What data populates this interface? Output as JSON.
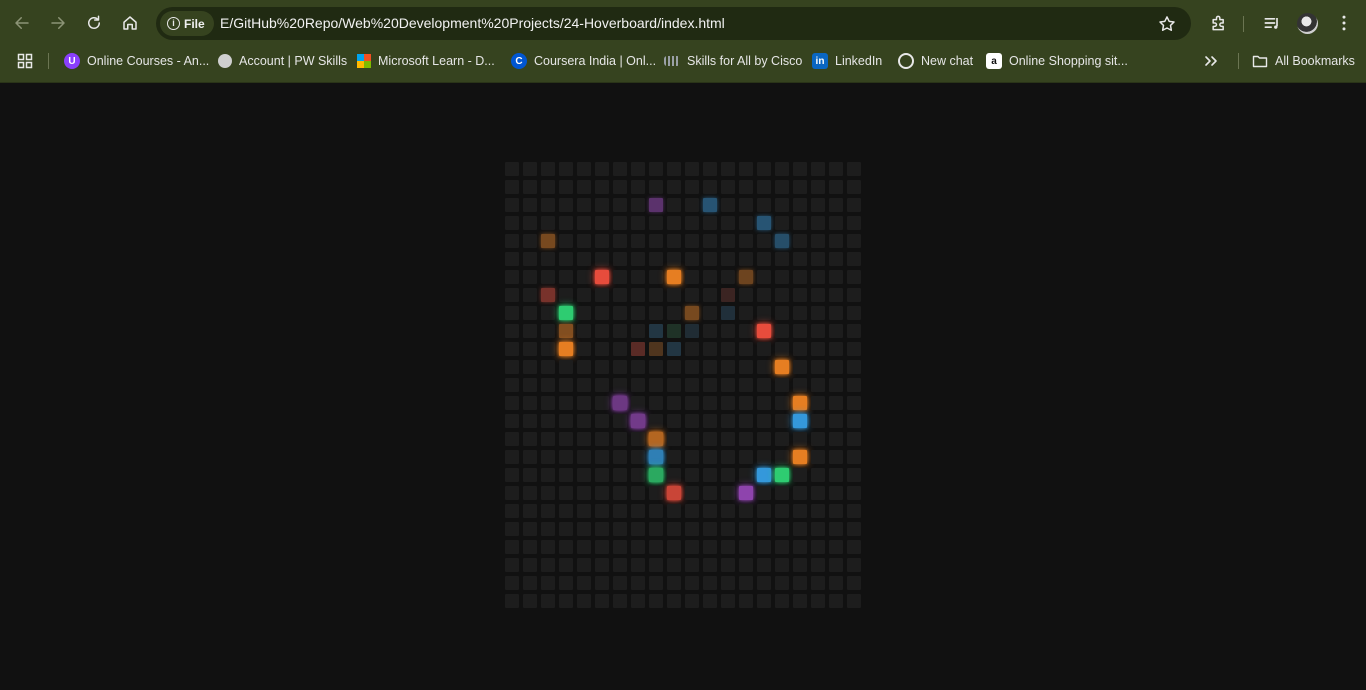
{
  "browser": {
    "site_chip_label": "File",
    "url": "E/GitHub%20Repo/Web%20Development%20Projects/24-Hoverboard/index.html",
    "bookmarks": [
      {
        "label": "Online Courses - An...",
        "icon": "udemy-icon",
        "color": "#8a3ffc"
      },
      {
        "label": "Account | PW Skills",
        "icon": "globe-icon",
        "color": "#cfcfcf"
      },
      {
        "label": "Microsoft Learn - D...",
        "icon": "microsoft-icon",
        "color": "#f25022"
      },
      {
        "label": "Coursera India | Onl...",
        "icon": "coursera-icon",
        "color": "#0056d2"
      },
      {
        "label": "Skills for All by Cisco",
        "icon": "cisco-icon",
        "color": "#9aa0a6"
      },
      {
        "label": "LinkedIn",
        "icon": "linkedin-icon",
        "color": "#0a66c2"
      },
      {
        "label": "New chat",
        "icon": "openai-icon",
        "color": "#ffffff"
      },
      {
        "label": "Online Shopping sit...",
        "icon": "amazon-icon",
        "color": "#ffffff"
      }
    ],
    "all_bookmarks_label": "All Bookmarks"
  },
  "board": {
    "columns": 20,
    "rows": 25,
    "base_color": "#1d1d1d",
    "page_background": "#111111",
    "lit_squares": [
      {
        "row": 2,
        "col": 8,
        "color": "#8e44ad",
        "intensity": 0.55
      },
      {
        "row": 2,
        "col": 11,
        "color": "#3498db",
        "intensity": 0.45
      },
      {
        "row": 3,
        "col": 14,
        "color": "#3498db",
        "intensity": 0.45
      },
      {
        "row": 4,
        "col": 2,
        "color": "#e67e22",
        "intensity": 0.45
      },
      {
        "row": 4,
        "col": 15,
        "color": "#3498db",
        "intensity": 0.4
      },
      {
        "row": 6,
        "col": 5,
        "color": "#e74c3c",
        "intensity": 1.0
      },
      {
        "row": 6,
        "col": 9,
        "color": "#e67e22",
        "intensity": 1.0
      },
      {
        "row": 6,
        "col": 13,
        "color": "#e67e22",
        "intensity": 0.4
      },
      {
        "row": 7,
        "col": 2,
        "color": "#e74c3c",
        "intensity": 0.45
      },
      {
        "row": 7,
        "col": 12,
        "color": "#e74c3c",
        "intensity": 0.15
      },
      {
        "row": 8,
        "col": 3,
        "color": "#2ecc71",
        "intensity": 1.0
      },
      {
        "row": 8,
        "col": 10,
        "color": "#e67e22",
        "intensity": 0.45
      },
      {
        "row": 8,
        "col": 12,
        "color": "#3498db",
        "intensity": 0.15
      },
      {
        "row": 9,
        "col": 3,
        "color": "#e67e22",
        "intensity": 0.5
      },
      {
        "row": 9,
        "col": 8,
        "color": "#3498db",
        "intensity": 0.2
      },
      {
        "row": 9,
        "col": 9,
        "color": "#2ecc71",
        "intensity": 0.12
      },
      {
        "row": 9,
        "col": 10,
        "color": "#3498db",
        "intensity": 0.12
      },
      {
        "row": 9,
        "col": 14,
        "color": "#e74c3c",
        "intensity": 1.0
      },
      {
        "row": 10,
        "col": 3,
        "color": "#e67e22",
        "intensity": 1.0
      },
      {
        "row": 10,
        "col": 7,
        "color": "#e74c3c",
        "intensity": 0.3
      },
      {
        "row": 10,
        "col": 8,
        "color": "#e67e22",
        "intensity": 0.25
      },
      {
        "row": 10,
        "col": 9,
        "color": "#3498db",
        "intensity": 0.2
      },
      {
        "row": 11,
        "col": 15,
        "color": "#e67e22",
        "intensity": 1.0
      },
      {
        "row": 13,
        "col": 6,
        "color": "#8e44ad",
        "intensity": 0.7
      },
      {
        "row": 13,
        "col": 16,
        "color": "#e67e22",
        "intensity": 1.0
      },
      {
        "row": 14,
        "col": 7,
        "color": "#8e44ad",
        "intensity": 0.75
      },
      {
        "row": 14,
        "col": 16,
        "color": "#3498db",
        "intensity": 1.0
      },
      {
        "row": 15,
        "col": 8,
        "color": "#e67e22",
        "intensity": 0.75
      },
      {
        "row": 16,
        "col": 8,
        "color": "#3498db",
        "intensity": 0.8
      },
      {
        "row": 16,
        "col": 16,
        "color": "#e67e22",
        "intensity": 1.0
      },
      {
        "row": 17,
        "col": 8,
        "color": "#2ecc71",
        "intensity": 0.8
      },
      {
        "row": 17,
        "col": 14,
        "color": "#3498db",
        "intensity": 1.0
      },
      {
        "row": 17,
        "col": 15,
        "color": "#2ecc71",
        "intensity": 1.0
      },
      {
        "row": 18,
        "col": 9,
        "color": "#e74c3c",
        "intensity": 0.85
      },
      {
        "row": 18,
        "col": 13,
        "color": "#8e44ad",
        "intensity": 1.0
      }
    ]
  }
}
